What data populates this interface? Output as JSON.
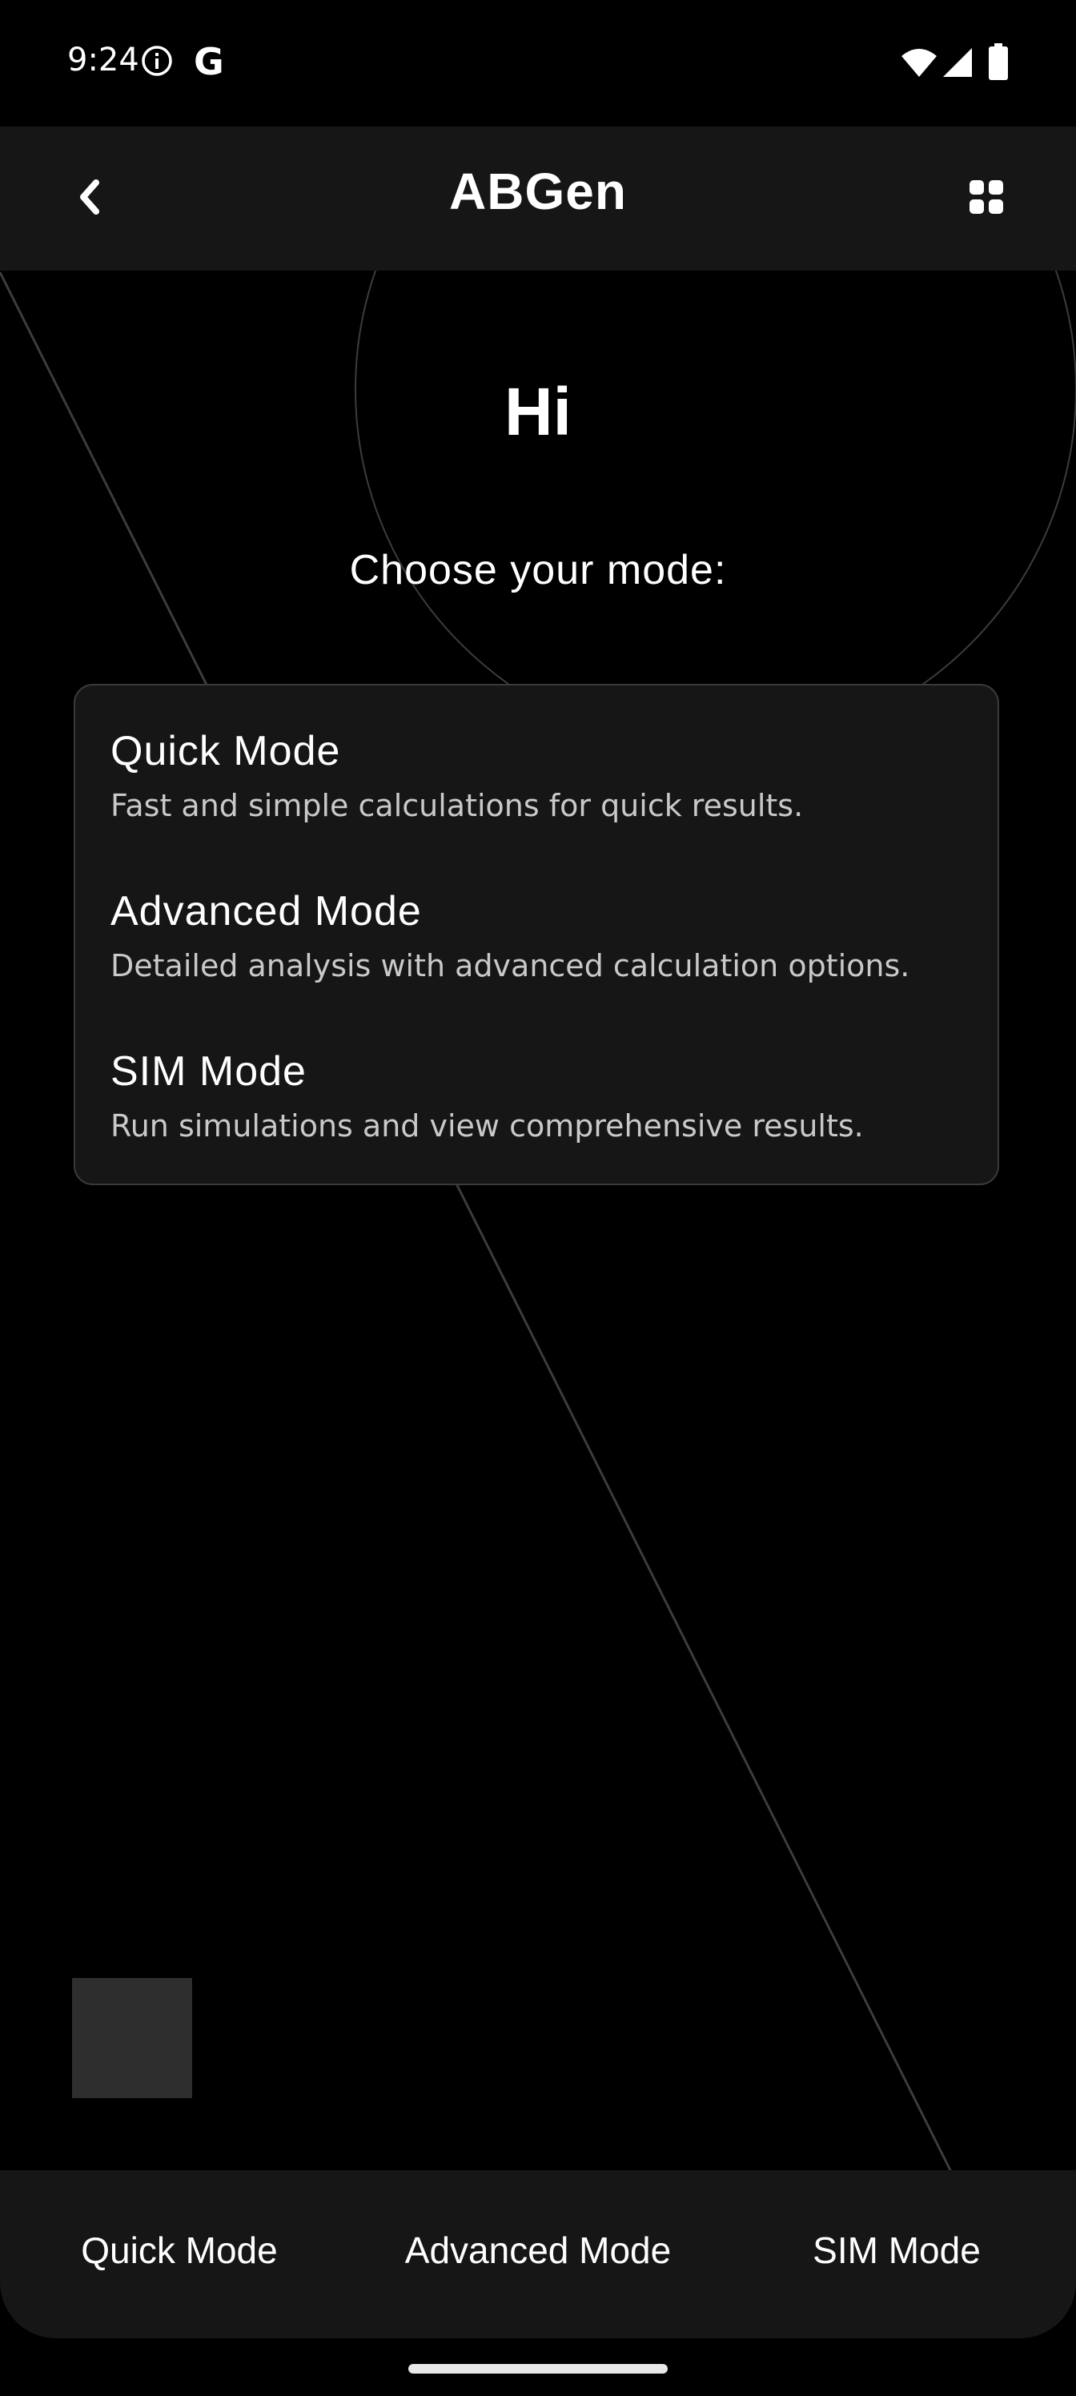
{
  "status_bar": {
    "time": "9:24",
    "icons": [
      "info-icon",
      "google-icon",
      "wifi-icon",
      "signal-icon",
      "battery-icon"
    ],
    "google_glyph": "G"
  },
  "app_bar": {
    "title": "ABGen",
    "back_icon": "chevron-left-icon",
    "menu_icon": "grid-icon"
  },
  "main": {
    "greeting": "Hi",
    "subtitle": "Choose your mode:",
    "modes": [
      {
        "title": "Quick Mode",
        "description": "Fast and simple calculations for quick results."
      },
      {
        "title": "Advanced Mode",
        "description": "Detailed analysis with advanced calculation options."
      },
      {
        "title": "SIM Mode",
        "description": "Run simulations and view comprehensive results."
      }
    ]
  },
  "bottom_nav": {
    "items": [
      {
        "label": "Quick Mode"
      },
      {
        "label": "Advanced Mode"
      },
      {
        "label": "SIM Mode"
      }
    ]
  },
  "colors": {
    "background": "#000000",
    "surface": "#161616",
    "card_border": "#3a3a3a",
    "text_primary": "#ffffff",
    "text_secondary": "#c9c9c9",
    "decor_line": "#3c3c3c"
  }
}
